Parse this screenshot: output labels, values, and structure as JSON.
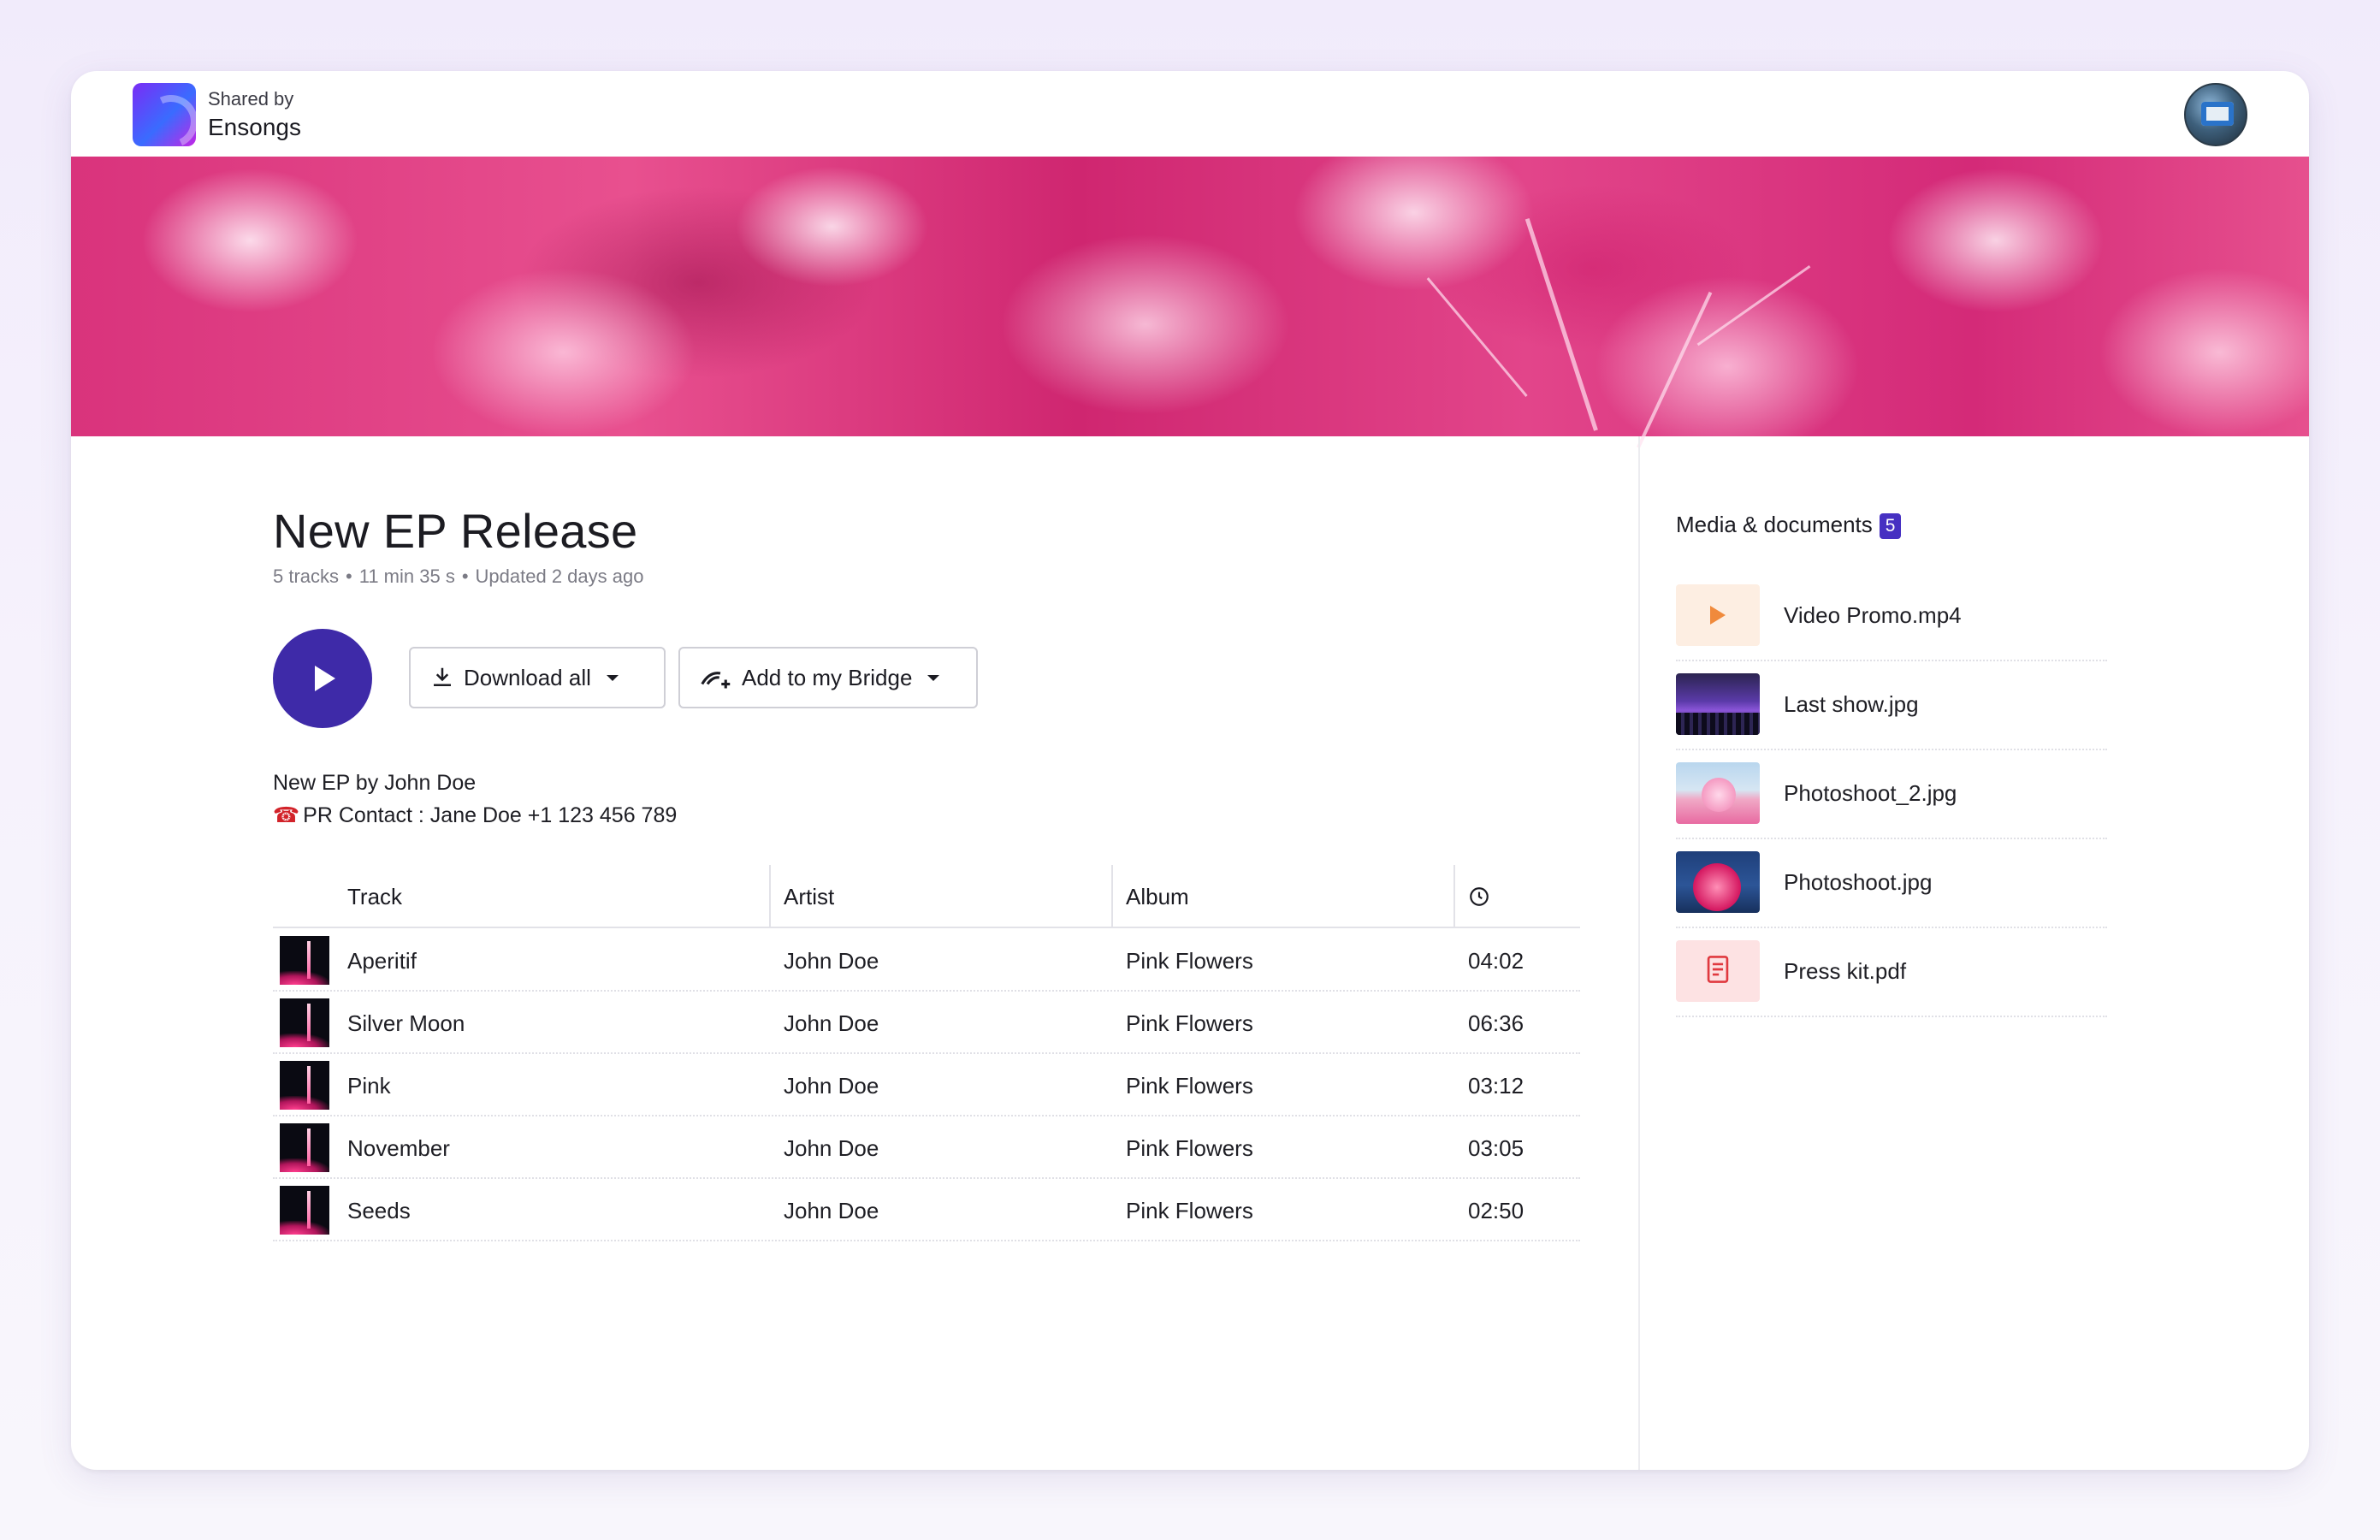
{
  "header": {
    "shared_by_label": "Shared by",
    "brand_name": "Ensongs"
  },
  "release": {
    "title": "New EP Release",
    "meta": {
      "tracks": "5 tracks",
      "duration": "11 min 35 s",
      "updated": "Updated 2 days ago"
    },
    "buttons": {
      "download_all": "Download all",
      "add_to_bridge": "Add to my Bridge"
    },
    "description_line1": "New EP by John Doe",
    "description_line2": "PR Contact : Jane Doe +1 123 456 789",
    "phone_emoji": "☎"
  },
  "table": {
    "columns": {
      "track": "Track",
      "artist": "Artist",
      "album": "Album"
    },
    "rows": [
      {
        "track": "Aperitif",
        "artist": "John Doe",
        "album": "Pink Flowers",
        "duration": "04:02"
      },
      {
        "track": "Silver Moon",
        "artist": "John Doe",
        "album": "Pink Flowers",
        "duration": "06:36"
      },
      {
        "track": "Pink",
        "artist": "John Doe",
        "album": "Pink Flowers",
        "duration": "03:12"
      },
      {
        "track": "November",
        "artist": "John Doe",
        "album": "Pink Flowers",
        "duration": "03:05"
      },
      {
        "track": "Seeds",
        "artist": "John Doe",
        "album": "Pink Flowers",
        "duration": "02:50"
      }
    ]
  },
  "media": {
    "title": "Media & documents",
    "count": "5",
    "items": [
      {
        "name": "Video Promo.mp4",
        "kind": "video"
      },
      {
        "name": "Last show.jpg",
        "kind": "image"
      },
      {
        "name": "Photoshoot_2.jpg",
        "kind": "image"
      },
      {
        "name": "Photoshoot.jpg",
        "kind": "image"
      },
      {
        "name": "Press kit.pdf",
        "kind": "pdf"
      }
    ]
  },
  "colors": {
    "accent": "#3e2aa8",
    "badge": "#4630c2",
    "banner": "#e2458a"
  },
  "icons": {
    "play": "play-icon",
    "download": "download-icon",
    "bridge": "bridge-icon",
    "clock": "clock-icon",
    "pdf": "document-icon"
  }
}
